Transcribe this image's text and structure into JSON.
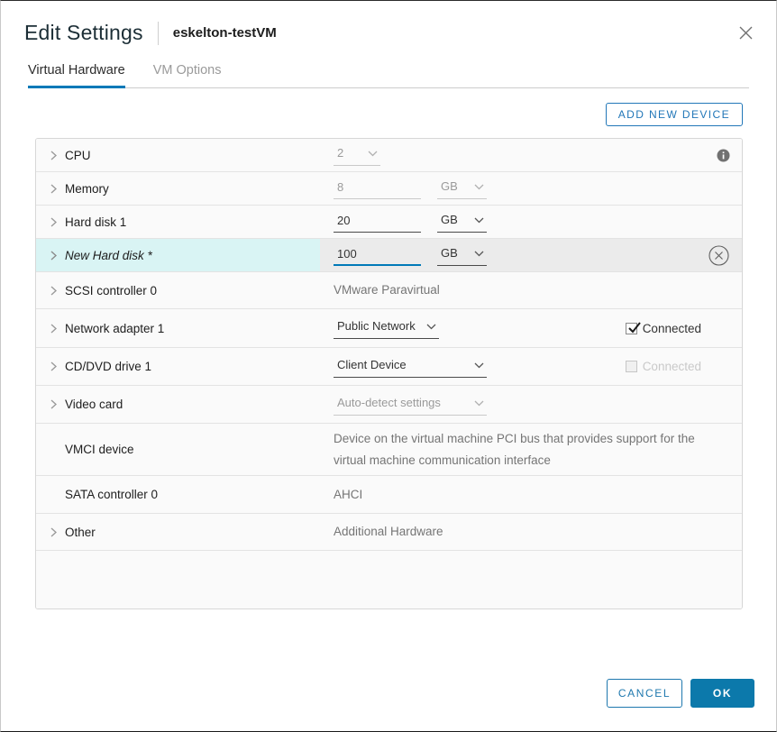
{
  "window": {
    "title": "Edit Settings",
    "vm_name": "eskelton-testVM"
  },
  "tabs": [
    {
      "label": "Virtual Hardware",
      "active": true
    },
    {
      "label": "VM Options",
      "active": false
    }
  ],
  "toolbar": {
    "add_device_label": "ADD NEW DEVICE"
  },
  "hardware_rows": [
    {
      "label": "CPU",
      "control": "dropdown",
      "value": "2",
      "state": "disabled",
      "expandable": true,
      "info_icon": true
    },
    {
      "label": "Memory",
      "control": "input-with-unit",
      "value": "8",
      "unit": "GB",
      "state": "disabled",
      "expandable": true
    },
    {
      "label": "Hard disk 1",
      "control": "input-with-unit",
      "value": "20",
      "unit": "GB",
      "state": "enabled",
      "expandable": true
    },
    {
      "label": "New Hard disk *",
      "control": "input-with-unit",
      "value": "100",
      "unit": "GB",
      "state": "focused",
      "expandable": true,
      "highlighted": true,
      "removable": true
    },
    {
      "label": "SCSI controller 0",
      "control": "static",
      "value": "VMware Paravirtual",
      "expandable": true
    },
    {
      "label": "Network adapter 1",
      "control": "dropdown",
      "value": "Public Network",
      "state": "enabled",
      "expandable": true,
      "checkbox_label": "Connected",
      "checkbox_checked": true,
      "checkbox_disabled": false
    },
    {
      "label": "CD/DVD drive 1",
      "control": "dropdown",
      "value": "Client Device",
      "state": "enabled",
      "expandable": true,
      "checkbox_label": "Connected",
      "checkbox_checked": false,
      "checkbox_disabled": true
    },
    {
      "label": "Video card",
      "control": "dropdown",
      "value": "Auto-detect settings",
      "state": "disabled",
      "expandable": true
    },
    {
      "label": "VMCI device",
      "control": "static",
      "value": "Device on the virtual machine PCI bus that provides support for the virtual machine communication interface",
      "expandable": false
    },
    {
      "label": "SATA controller 0",
      "control": "static",
      "value": "AHCI",
      "expandable": false
    },
    {
      "label": "Other",
      "control": "static",
      "value": "Additional Hardware",
      "expandable": true
    }
  ],
  "footer": {
    "cancel_label": "CANCEL",
    "ok_label": "OK"
  },
  "colors": {
    "accent_blue": "#0079b8",
    "ok_button_bg": "#0c79ab",
    "highlight_cell": "#d9f4f4",
    "highlight_row": "#ebebeb",
    "table_row_bg": "#fafafa",
    "divider": "#e3e3e3",
    "disabled_text": "#9a9a9a",
    "muted_value_text": "#757575",
    "label_text": "#1d1d1d"
  }
}
